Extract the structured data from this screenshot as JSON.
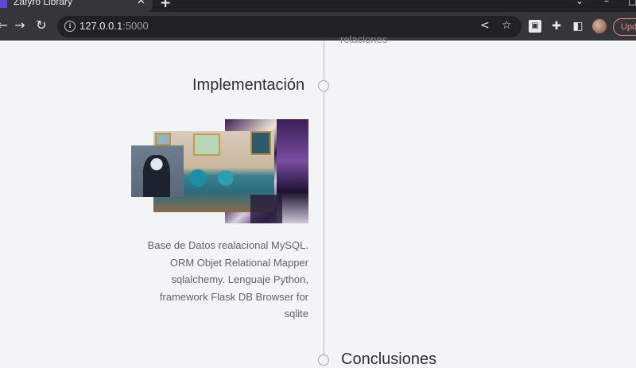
{
  "browser": {
    "tab_title": "Zafyro Library",
    "url_host": "127.0.0.1",
    "url_port": ":5000",
    "update_label": "Upd"
  },
  "page": {
    "previous_text": "relaciones",
    "implementation": {
      "title": "Implementación",
      "description": "Base de Datos realacional MySQL. ORM Objet Relational Mapper sqlalchemy. Lenguaje Python, framework Flask DB Browser for sqlite"
    },
    "next_title": "Conclusiones"
  },
  "icons": {
    "back": "arrow-left-icon",
    "forward": "arrow-right-icon",
    "reload": "reload-icon",
    "info": "info-icon",
    "share": "share-icon",
    "bookmark": "star-icon",
    "extensions": "puzzle-icon"
  },
  "colors": {
    "page_bg": "#f3f4f6",
    "chrome_dark": "#202124",
    "chrome_toolbar": "#35363a",
    "update_accent": "#f28b82"
  }
}
